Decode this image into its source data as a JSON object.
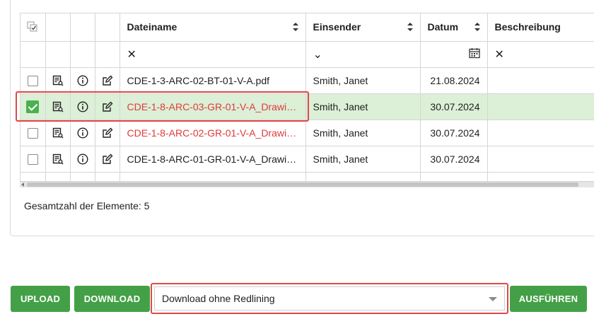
{
  "grid": {
    "columns": {
      "filename": "Dateiname",
      "sender": "Einsender",
      "date": "Datum",
      "description": "Beschreibung"
    },
    "filters": {
      "filename_clear": "✕",
      "sender_dropdown": "⌄",
      "description_clear": "✕"
    },
    "rows": [
      {
        "checked": false,
        "filename": "CDE-1-3-ARC-02-BT-01-V-A.pdf",
        "filename_red": false,
        "sender": "Smith, Janet",
        "date": "21.08.2024",
        "description": ""
      },
      {
        "checked": true,
        "filename": "CDE-1-8-ARC-03-GR-01-V-A_Drawing_...",
        "filename_red": true,
        "sender": "Smith, Janet",
        "date": "30.07.2024",
        "description": ""
      },
      {
        "checked": false,
        "filename": "CDE-1-8-ARC-02-GR-01-V-A_Drawing_...",
        "filename_red": true,
        "sender": "Smith, Janet",
        "date": "30.07.2024",
        "description": ""
      },
      {
        "checked": false,
        "filename": "CDE-1-8-ARC-01-GR-01-V-A_Drawing_...",
        "filename_red": false,
        "sender": "Smith, Janet",
        "date": "30.07.2024",
        "description": ""
      }
    ]
  },
  "total_label": "Gesamtzahl der Elemente: 5",
  "actions": {
    "upload": "UPLOAD",
    "download": "DOWNLOAD",
    "select_value": "Download ohne Redlining",
    "execute": "AUSFÜHREN"
  },
  "colors": {
    "accent_green": "#43a047",
    "selected_row": "#dcefd7",
    "highlight_red": "#e04848",
    "link_red": "#e03a3a"
  }
}
